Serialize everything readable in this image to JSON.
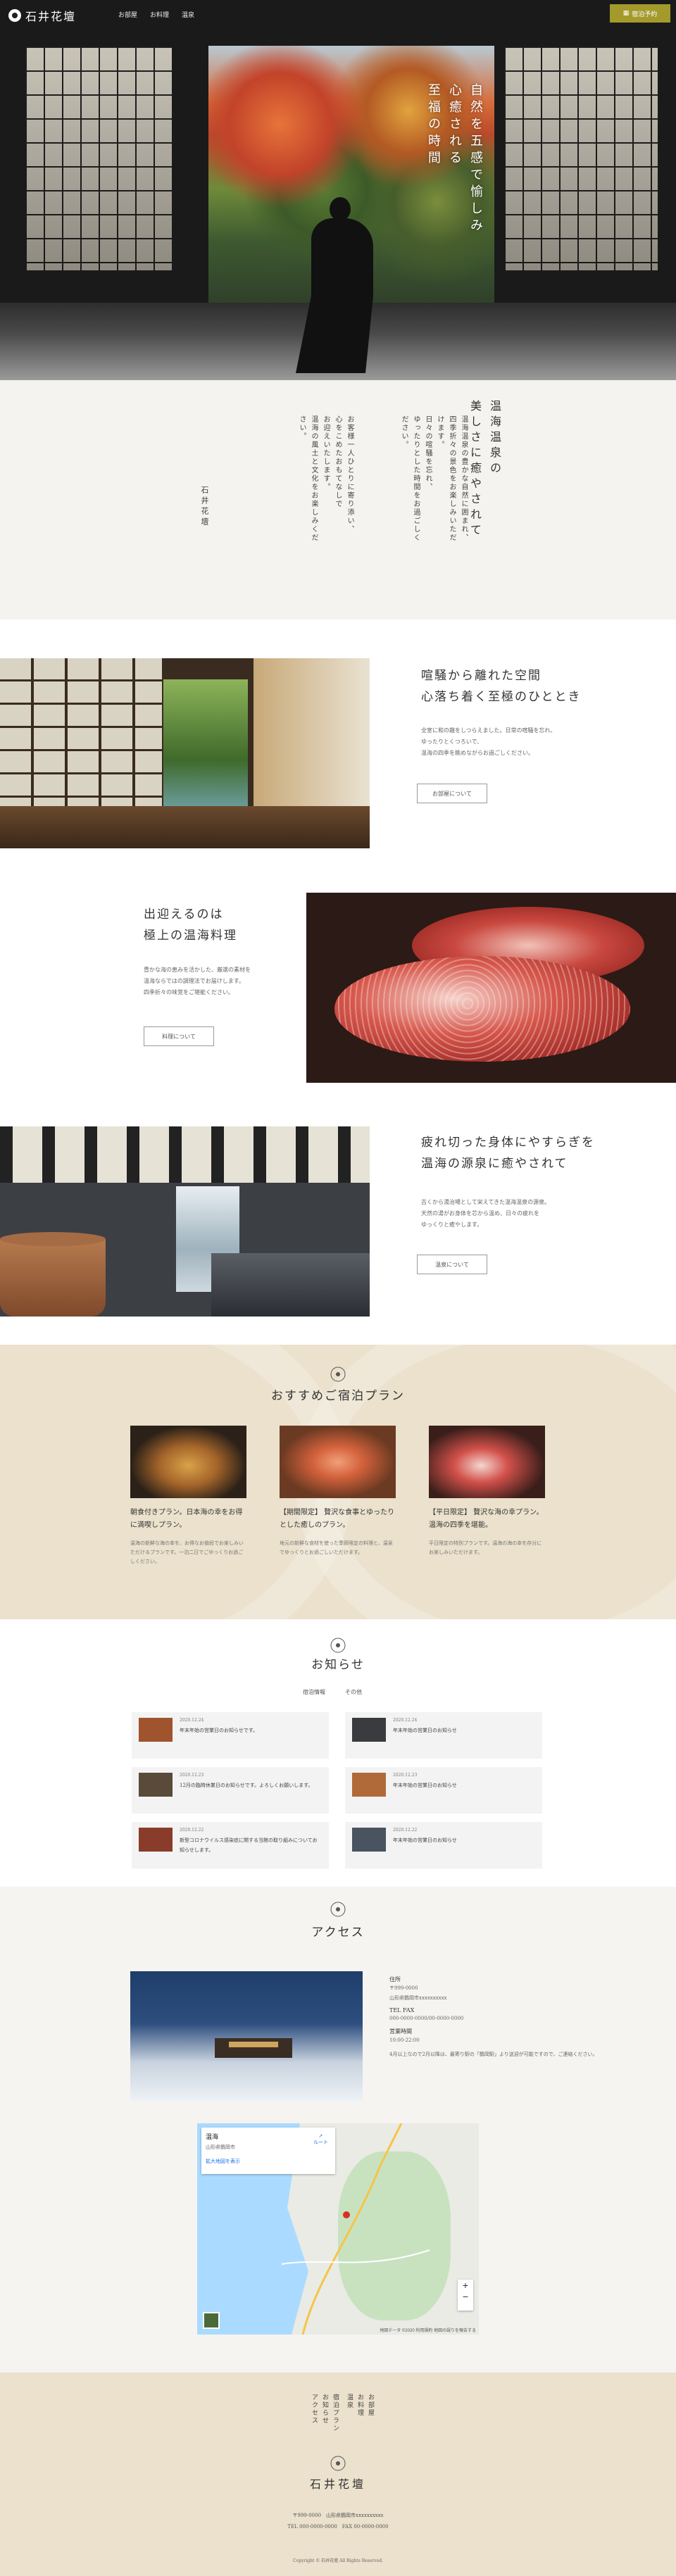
{
  "header": {
    "logo": "石井花壇",
    "nav": [
      "お部屋",
      "お料理",
      "温泉"
    ],
    "reserve": "宿泊予約"
  },
  "hero": {
    "copy_lines": [
      "自然を五感で愉しみ",
      "心癒される",
      "至福の時間"
    ]
  },
  "intro": {
    "title_lines": [
      "温海温泉の",
      "美しさに癒やされて"
    ],
    "para1": [
      "温海温泉の豊かな自然に囲まれ、",
      "四季折々の景色をお楽しみいただけます。",
      "日々の喧騒を忘れ、",
      "ゆったりとした時間をお過ごしください。"
    ],
    "para2": [
      "お客様一人ひとりに寄り添い、",
      "心をこめたおもてなしで",
      "お迎えいたします。",
      "温海の風土と文化をお楽しみください。"
    ],
    "signature": "石井花壇"
  },
  "features": [
    {
      "title_lines": [
        "喧騒から離れた空間",
        "心落ち着く至極のひととき"
      ],
      "text": [
        "全室に和の趣をしつらえました。日常の喧騒を忘れ、",
        "ゆったりとくつろいで、",
        "温海の四季を眺めながらお過ごしください。"
      ],
      "button": "お部屋について"
    },
    {
      "title_lines": [
        "出迎えるのは",
        "極上の温海料理"
      ],
      "text": [
        "豊かな海の恵みを活かした、厳選の素材を",
        "温海ならではの調理法でお届けします。",
        "四季折々の味覚をご堪能ください。"
      ],
      "button": "料理について"
    },
    {
      "title_lines": [
        "疲れ切った身体にやすらぎを",
        "温海の源泉に癒やされて"
      ],
      "text": [
        "古くから湯治場として栄えてきた温海温泉の源泉。",
        "天然の湯がお身体を芯から温め、日々の疲れを",
        "ゆっくりと癒やします。"
      ],
      "button": "温泉について"
    }
  ],
  "plans": {
    "title": "おすすめご宿泊プラン",
    "items": [
      {
        "name": "朝食付きプラン。日本海の幸をお得に満喫しプラン。",
        "desc": "温海の新鮮な海の幸を、お得なお値段でお楽しみいただけるプランです。一泊二日でごゆっくりお過ごしください。"
      },
      {
        "name": "【期間限定】 贅沢な食事とゆったりとした癒しのプラン。",
        "desc": "地元の新鮮な食材を使った季節限定の料理と、温泉でゆっくりとお過ごしいただけます。"
      },
      {
        "name": "【平日限定】 贅沢な海の幸プラン。温海の四季を堪能。",
        "desc": "平日限定の特別プランです。温海の海の幸を存分にお楽しみいただけます。"
      }
    ]
  },
  "news": {
    "title": "お知らせ",
    "tabs": [
      "宿泊情報",
      "その他"
    ],
    "items": [
      {
        "date": "2020.12.24",
        "text": "年末年始の営業日のお知らせです。"
      },
      {
        "date": "2020.12.24",
        "text": "年末年始の営業日のお知らせ"
      },
      {
        "date": "2020.12.23",
        "text": "12月の臨時休業日のお知らせです。よろしくお願いします。"
      },
      {
        "date": "2020.12.23",
        "text": "年末年始の営業日のお知らせ"
      },
      {
        "date": "2020.12.22",
        "text": "新型コロナウイルス感染症に関する当館の取り組みについてお知らせします。"
      },
      {
        "date": "2020.12.22",
        "text": "年末年始の営業日のお知らせ"
      }
    ]
  },
  "access": {
    "title": "アクセス",
    "name_label": "住所",
    "address": "〒999-0000",
    "address2": "山形県鶴岡市xxxxxxxxxx",
    "tel_label": "TEL FAX",
    "tel": "000-0000-0000/00-0000-0000",
    "hours_label": "営業時間",
    "hours": "10:00-22:00",
    "note": "4月以上なので2月以降は、最寄り駅の「鶴岡駅」より送迎が可能ですので、ご連絡ください。",
    "map": {
      "place": "温海",
      "place_sub": "山形県鶴岡市",
      "link": "拡大地図を表示",
      "route": "ルート",
      "zoom_in": "+",
      "zoom_out": "−",
      "footer": "地図データ ©2020 利用規約 地図の誤りを報告する"
    }
  },
  "footer": {
    "nav": [
      "お部屋",
      "お料理",
      "温泉",
      "宿泊プラン",
      "お知らせ",
      "アクセス"
    ],
    "logo": "石井花壇",
    "address": "〒999-0000　山形県鶴岡市xxxxxxxxxx",
    "tel": "TEL 000-0000-0000　FAX 00-0000-0000",
    "copyright": "Copyright © 石井花壇 All Rights Reserved."
  }
}
